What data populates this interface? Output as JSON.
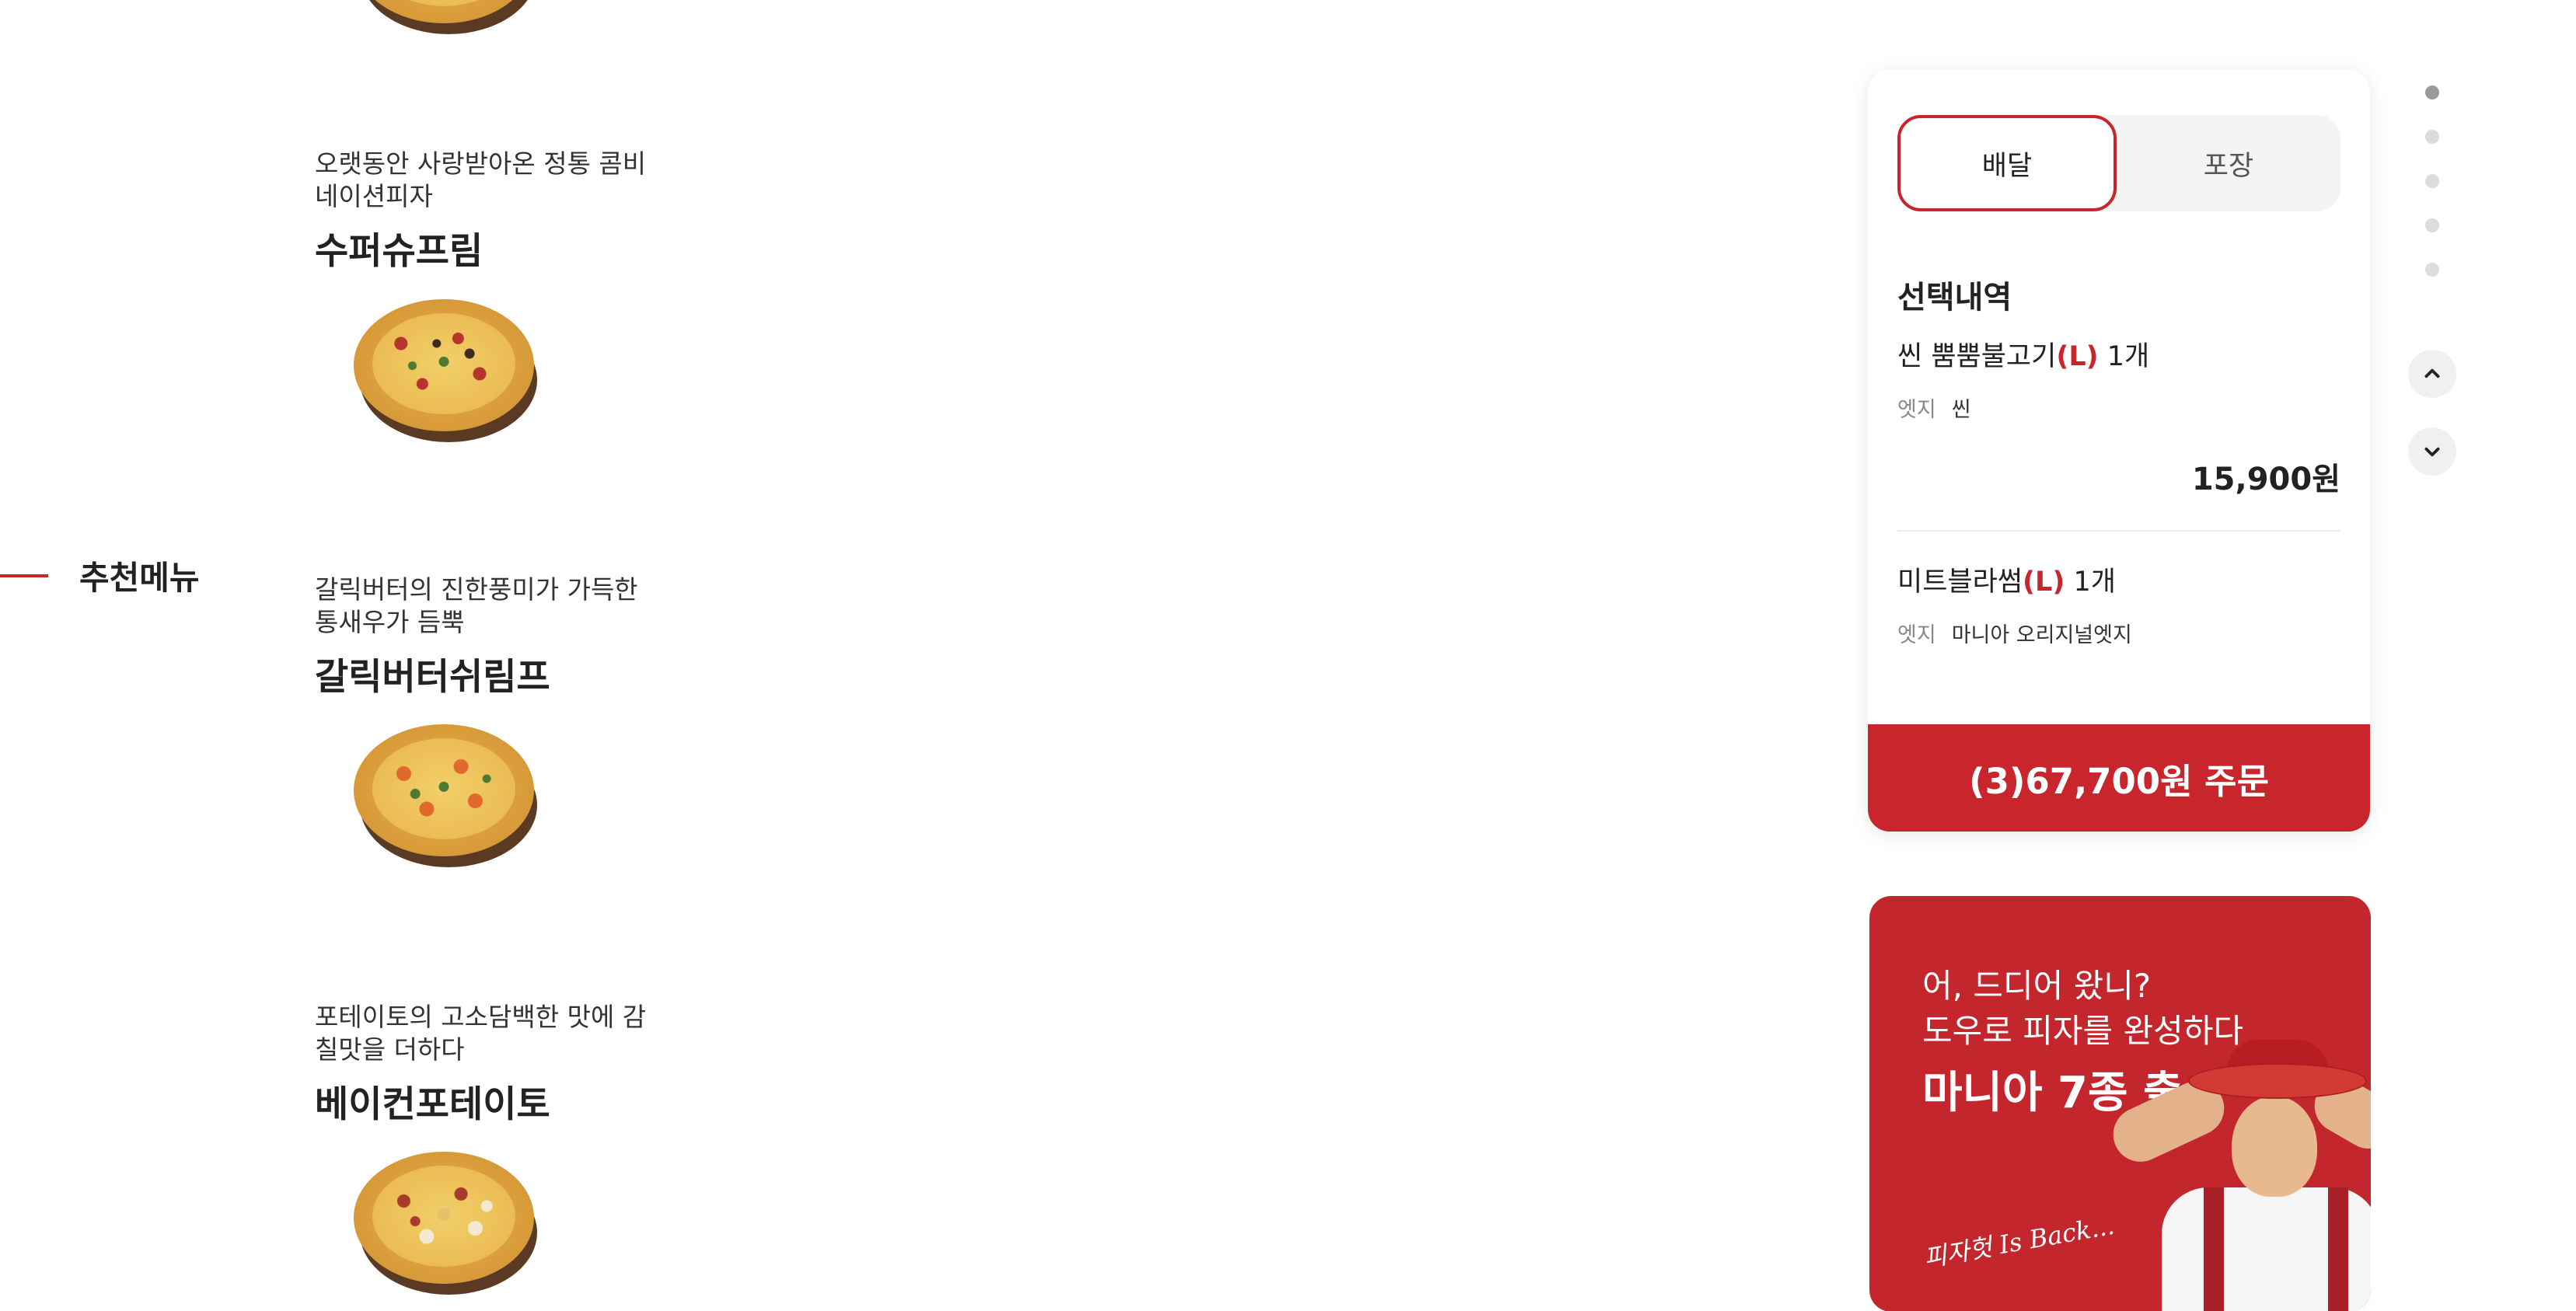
{
  "section": {
    "title": "추천메뉴"
  },
  "menu_items": [
    {
      "desc": "오랫동안 사랑받아온 정통 콤비네이션피자",
      "name": "수퍼슈프림"
    },
    {
      "desc": "갈릭버터의 진한풍미가 가득한 통새우가 듬뿍",
      "name": "갈릭버터쉬림프"
    },
    {
      "desc": "포테이토의 고소담백한 맛에 감칠맛을 더하다",
      "name": "베이컨포테이토"
    }
  ],
  "order": {
    "tabs": {
      "delivery": "배달",
      "pickup": "포장"
    },
    "selection_title": "선택내역",
    "items": [
      {
        "name": "씬 뿜뿜불고기",
        "size": "(L)",
        "qty": "1개",
        "opt_label": "엣지",
        "opt_value": "씬",
        "price": "15,900원"
      },
      {
        "name": "미트블라썸",
        "size": "(L)",
        "qty": "1개",
        "opt_label": "엣지",
        "opt_value": "마니아 오리지널엣지"
      }
    ],
    "order_button": "(3)67,700원 주문"
  },
  "banner": {
    "line1": "어, 드디어 왔니?",
    "line2": "도우로 피자를 완성하다",
    "headline": "마니아 7종 출시",
    "script": "피자헛 Is Back..."
  },
  "colors": {
    "accent": "#c8252c",
    "banner_bg": "#c3262d"
  },
  "icons": {
    "up": "chevron-up-icon",
    "down": "chevron-down-icon"
  }
}
